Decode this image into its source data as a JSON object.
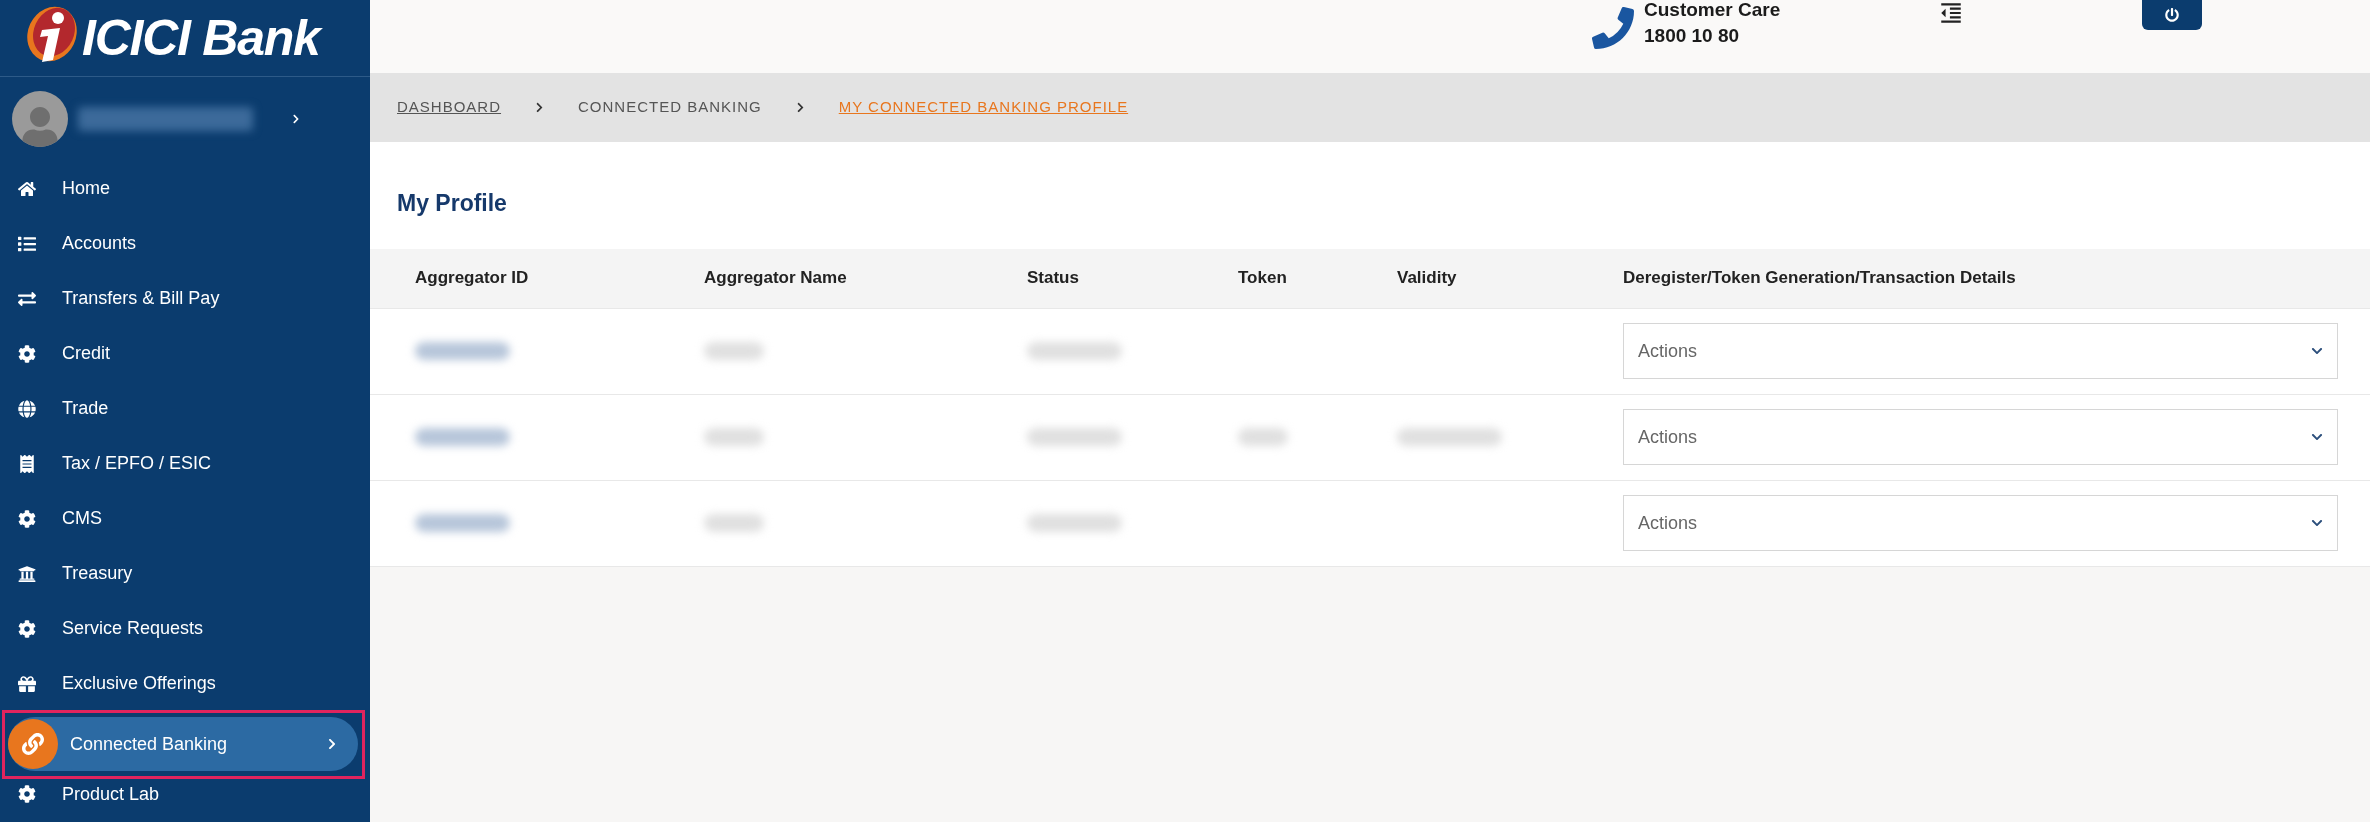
{
  "logo": {
    "text": "ICICI Bank"
  },
  "user": {
    "name_blurred": true
  },
  "sidebar": {
    "items": [
      {
        "label": "Home",
        "selected": false,
        "highlighted": false
      },
      {
        "label": "Accounts",
        "selected": false,
        "highlighted": false
      },
      {
        "label": "Transfers & Bill Pay",
        "selected": false,
        "highlighted": false
      },
      {
        "label": "Credit",
        "selected": false,
        "highlighted": false
      },
      {
        "label": "Trade",
        "selected": false,
        "highlighted": false
      },
      {
        "label": "Tax / EPFO / ESIC",
        "selected": false,
        "highlighted": false
      },
      {
        "label": "CMS",
        "selected": false,
        "highlighted": false
      },
      {
        "label": "Treasury",
        "selected": false,
        "highlighted": false
      },
      {
        "label": "Service Requests",
        "selected": false,
        "highlighted": false
      },
      {
        "label": "Exclusive Offerings",
        "selected": false,
        "highlighted": false
      },
      {
        "label": "Connected Banking",
        "selected": true,
        "highlighted": true
      },
      {
        "label": "Product Lab",
        "selected": false,
        "highlighted": false
      }
    ]
  },
  "header": {
    "customer_care_label": "Customer Care",
    "customer_care_number": "1800 10 80"
  },
  "breadcrumb": [
    {
      "label": "DASHBOARD",
      "selected": false
    },
    {
      "label": "CONNECTED BANKING",
      "selected": false
    },
    {
      "label": "MY CONNECTED BANKING PROFILE",
      "selected": true
    }
  ],
  "page_title": "My Profile",
  "table": {
    "columns": [
      "Aggregator ID",
      "Aggregator Name",
      "Status",
      "Token",
      "Validity",
      "Deregister/Token Generation/Transaction Details"
    ],
    "rows": [
      {
        "blurred": [
          true,
          true,
          true,
          false,
          false
        ],
        "action": "Actions"
      },
      {
        "blurred": [
          true,
          true,
          true,
          true,
          true
        ],
        "action": "Actions"
      },
      {
        "blurred": [
          true,
          true,
          true,
          false,
          false
        ],
        "action": "Actions"
      }
    ]
  }
}
